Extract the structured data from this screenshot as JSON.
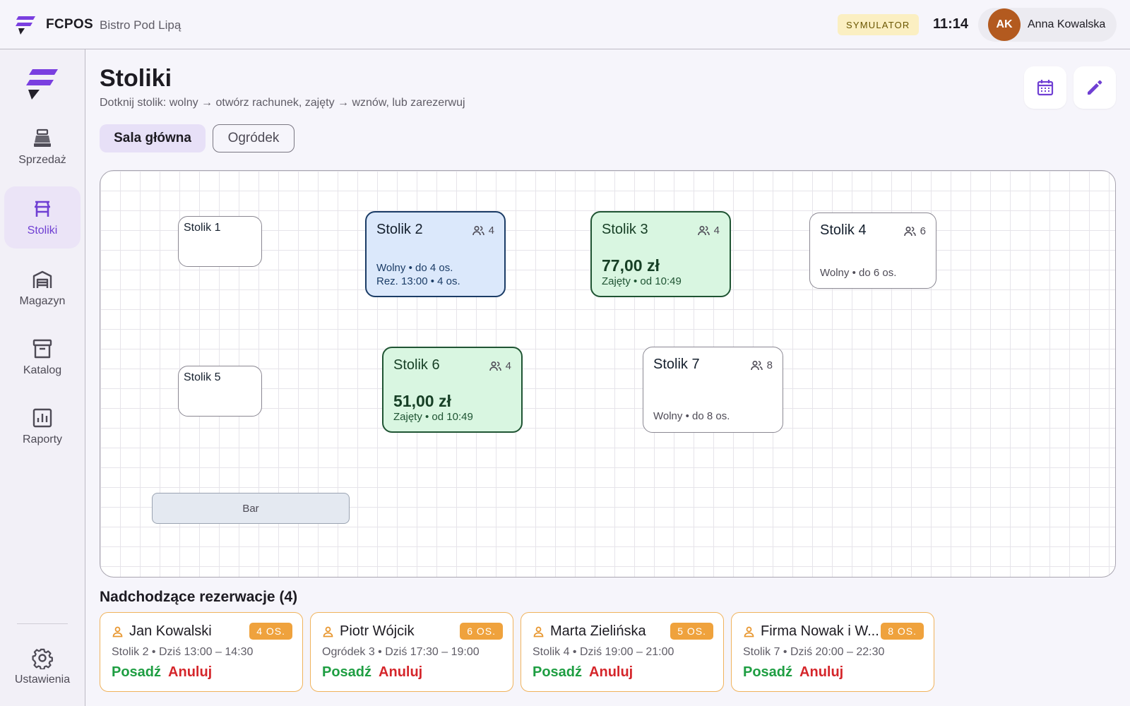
{
  "topbar": {
    "brand": "FCPOS",
    "venue": "Bistro Pod Lipą",
    "mode_badge": "SYMULATOR",
    "clock": "11:14",
    "user": {
      "initials": "AK",
      "name": "Anna Kowalska",
      "avatar_color": "#b35a1f"
    }
  },
  "sidebar": {
    "items": [
      {
        "label": "Sprzedaż",
        "icon": "cash-register-icon"
      },
      {
        "label": "Stoliki",
        "icon": "table-icon",
        "active": true
      },
      {
        "label": "Magazyn",
        "icon": "warehouse-icon"
      },
      {
        "label": "Katalog",
        "icon": "archive-box-icon"
      },
      {
        "label": "Raporty",
        "icon": "bar-chart-icon"
      }
    ],
    "settings": {
      "label": "Ustawienia",
      "icon": "gear-icon"
    }
  },
  "page": {
    "title": "Stoliki",
    "subtitle": "Dotknij stolik: wolny → otwórz rachunek, zajęty → wznów, lub zarezerwuj",
    "actions": {
      "calendar_icon": "calendar-icon",
      "edit_icon": "pencil-icon"
    }
  },
  "rooms": [
    {
      "label": "Sala główna",
      "active": true
    },
    {
      "label": "Ogródek",
      "active": false
    }
  ],
  "floor": {
    "tables": [
      {
        "name": "Stolik 1",
        "state": "empty"
      },
      {
        "name": "Stolik 2",
        "state": "reserved",
        "capacity": "4",
        "status": "Wolny • do 4 os.",
        "reservation": "Rez. 13:00 • 4 os."
      },
      {
        "name": "Stolik 3",
        "state": "busy",
        "capacity": "4",
        "amount": "77,00 zł",
        "status": "Zajęty • od 10:49"
      },
      {
        "name": "Stolik 4",
        "state": "free",
        "capacity": "6",
        "status": "Wolny • do 6 os."
      },
      {
        "name": "Stolik 5",
        "state": "empty"
      },
      {
        "name": "Stolik 6",
        "state": "busy",
        "capacity": "4",
        "amount": "51,00 zł",
        "status": "Zajęty • od 10:49"
      },
      {
        "name": "Stolik 7",
        "state": "free",
        "capacity": "8",
        "status": "Wolny • do 8 os."
      }
    ],
    "fixtures": [
      {
        "label": "Bar"
      }
    ]
  },
  "reservations": {
    "title": "Nadchodzące rezerwacje (4)",
    "seat_label": "Posadź",
    "cancel_label": "Anuluj",
    "items": [
      {
        "name": "Jan Kowalski",
        "guests": "4 OS.",
        "info": "Stolik 2 • Dziś 13:00 – 14:30"
      },
      {
        "name": "Piotr Wójcik",
        "guests": "6 OS.",
        "info": "Ogródek 3 • Dziś 17:30 – 19:00"
      },
      {
        "name": "Marta Zielińska",
        "guests": "5 OS.",
        "info": "Stolik 4 • Dziś 19:00 – 21:00"
      },
      {
        "name": "Firma Nowak i W...",
        "guests": "8 OS.",
        "info": "Stolik 7 • Dziś 20:00 – 22:30"
      }
    ]
  },
  "colors": {
    "accent": "#6f3fd3",
    "reserved_fill": "#dbe8fb",
    "busy_fill": "#d9f6e1",
    "reservation_border": "#f0b35c",
    "seat_action": "#1e9e42",
    "cancel_action": "#d5262b"
  }
}
